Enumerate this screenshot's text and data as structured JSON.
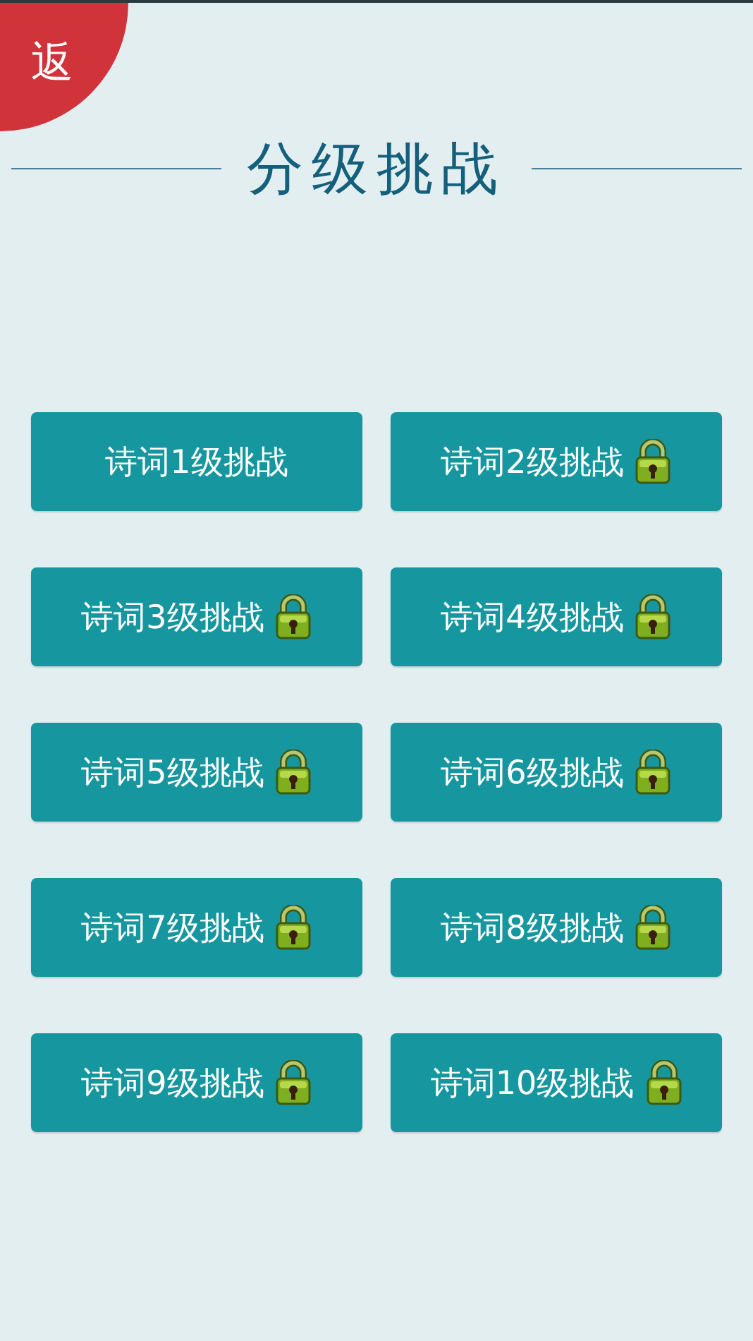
{
  "back_button": {
    "label": "返"
  },
  "title": "分级挑战",
  "levels": [
    {
      "label": "诗词1级挑战",
      "locked": false
    },
    {
      "label": "诗词2级挑战",
      "locked": true
    },
    {
      "label": "诗词3级挑战",
      "locked": true
    },
    {
      "label": "诗词4级挑战",
      "locked": true
    },
    {
      "label": "诗词5级挑战",
      "locked": true
    },
    {
      "label": "诗词6级挑战",
      "locked": true
    },
    {
      "label": "诗词7级挑战",
      "locked": true
    },
    {
      "label": "诗词8级挑战",
      "locked": true
    },
    {
      "label": "诗词9级挑战",
      "locked": true
    },
    {
      "label": "诗词10级挑战",
      "locked": true
    }
  ]
}
